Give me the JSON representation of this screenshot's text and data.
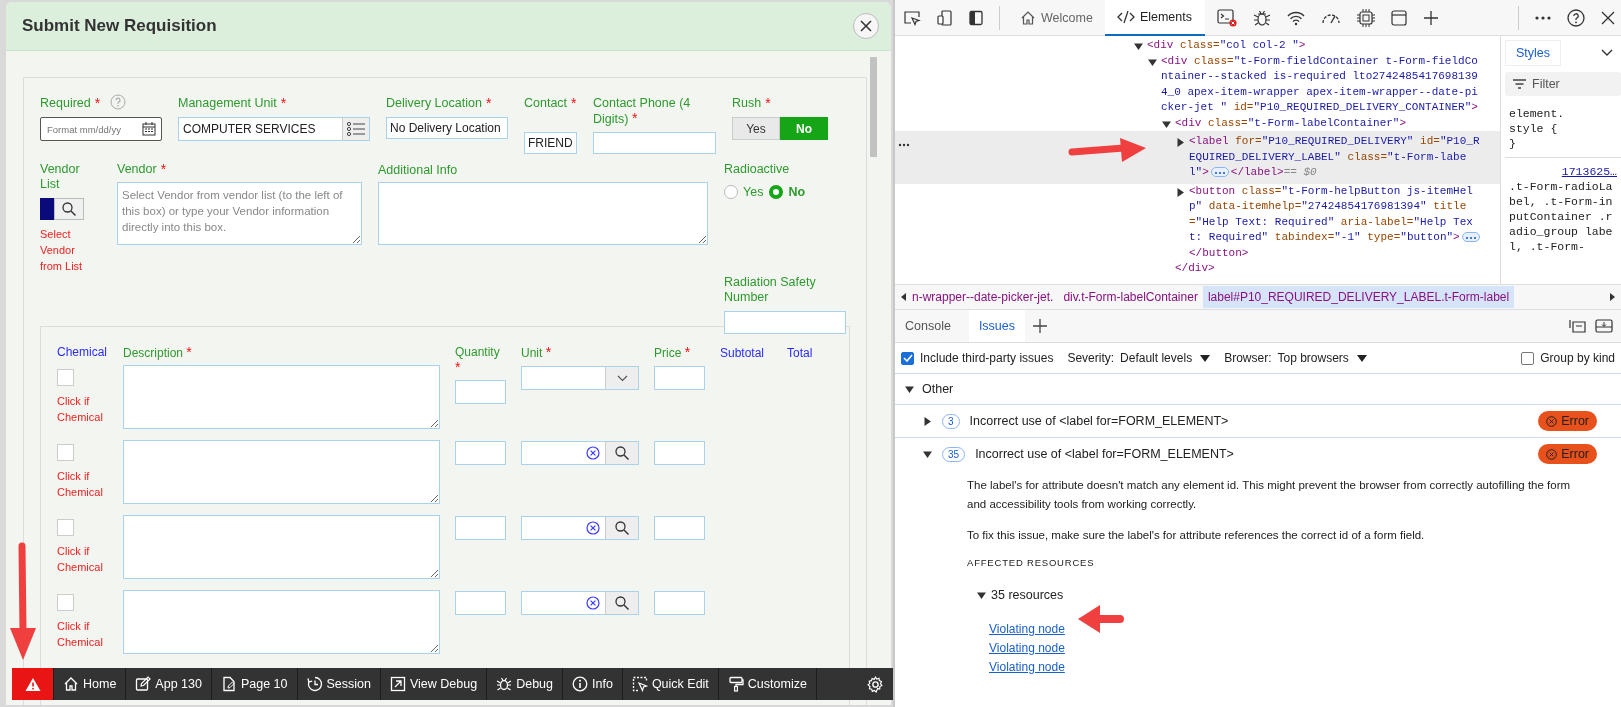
{
  "dialog": {
    "title": "Submit New Requisition",
    "required": {
      "label": "Required",
      "required_mark": "*",
      "placeholder": "Format mm/dd/yy"
    },
    "management_unit": {
      "label": "Management Unit",
      "required_mark": "*",
      "value": "COMPUTER SERVICES"
    },
    "delivery_location": {
      "label": "Delivery Location",
      "required_mark": "*",
      "value": "No Delivery Location"
    },
    "contact": {
      "label": "Contact",
      "required_mark": "*",
      "value": "FRIEND"
    },
    "contact_phone": {
      "label": "Contact Phone (4 Digits)",
      "required_mark": "*"
    },
    "rush": {
      "label": "Rush",
      "required_mark": "*",
      "options": [
        {
          "label": "Yes",
          "selected": false
        },
        {
          "label": "No",
          "selected": true
        }
      ]
    },
    "vendor_list": {
      "label": "Vendor List",
      "hint": "Select Vendor from List"
    },
    "vendor": {
      "label": "Vendor",
      "required_mark": "*",
      "placeholder": "Select Vendor from vendor list (to the left of this box) or type your Vendor information directly into this box."
    },
    "additional_info": {
      "label": "Additional Info"
    },
    "radioactive": {
      "label": "Radioactive",
      "options": [
        {
          "label": "Yes",
          "selected": false
        },
        {
          "label": "No",
          "selected": true
        }
      ]
    },
    "radiation_safety_number": {
      "label": "Radiation Safety Number"
    },
    "line_items": {
      "columns": [
        {
          "label": "Chemical",
          "color": "#2b2bff"
        },
        {
          "label": "Description",
          "required_mark": "*",
          "color": "#2e9a2e"
        },
        {
          "label": "Quantity",
          "required_mark": "*",
          "color": "#2e9a2e"
        },
        {
          "label": "Unit",
          "required_mark": "*",
          "color": "#2e9a2e"
        },
        {
          "label": "Price",
          "required_mark": "*",
          "color": "#2e9a2e"
        },
        {
          "label": "Subtotal",
          "color": "#2b2bff"
        },
        {
          "label": "Total",
          "color": "#2b2bff"
        }
      ],
      "rows": [
        {
          "checked": false,
          "hint": "Click if Chemical",
          "kind": "select"
        },
        {
          "checked": false,
          "hint": "Click if Chemical",
          "kind": "lookup"
        },
        {
          "checked": false,
          "hint": "Click if Chemical",
          "kind": "lookup"
        },
        {
          "checked": false,
          "hint": "Click if Chemical",
          "kind": "lookup"
        }
      ]
    }
  },
  "dev_toolbar": [
    "Home",
    "App 130",
    "Page 10",
    "Session",
    "View Debug",
    "Debug",
    "Info",
    "Quick Edit",
    "Customize"
  ],
  "devtools": {
    "tabs": [
      {
        "label": "Welcome",
        "selected": false
      },
      {
        "label": "Elements",
        "selected": true
      }
    ],
    "tree": [
      {
        "text": "<div class=\"col col-2 \">",
        "expanded": true,
        "selected": false,
        "children": [
          {
            "text": "<div class=\"t-Form-fieldContainer t-Form-fieldContainer--stacked is-required lto27424854176981394_0 apex-item-wrapper apex-item-wrapper--date-picker-jet \" id=\"P10_REQUIRED_DELIVERY_CONTAINER\">",
            "expanded": true,
            "selected": false,
            "children": [
              {
                "text": "<div class=\"t-Form-labelContainer\">",
                "expanded": true,
                "selected": false,
                "close": "</div>",
                "children": [
                  {
                    "text": "<label for=\"P10_REQUIRED_DELIVERY\" id=\"P10_REQUIRED_DELIVERY_LABEL\" class=\"t-Form-label\">",
                    "expanded": false,
                    "selected": true,
                    "close": "</label>",
                    "suffix": "== $0"
                  },
                  {
                    "text": "<button class=\"t-Form-helpButton js-itemHelp\" data-itemhelp=\"27424854176981394\" title=\"Help Text: Required\" aria-label=\"Help Text: Required\" tabindex=\"-1\" type=\"button\">",
                    "expanded": false,
                    "selected": false,
                    "close": "</button>"
                  }
                ]
              }
            ]
          }
        ]
      }
    ],
    "styles": {
      "tab": "Styles",
      "filter": "Filter",
      "lines": [
        "element.",
        "style {",
        "}"
      ],
      "link": "1713625…",
      "rule": ".t-Form-radioLabel, .t-Form-inputContainer .radio_group label, .t-Form-"
    },
    "breadcrumbs": [
      {
        "label": "n-wrapper--date-picker-jet.",
        "selected": false
      },
      {
        "label": "div.t-Form-labelContainer",
        "selected": false
      },
      {
        "label": "label#P10_REQUIRED_DELIVERY_LABEL.t-Form-label",
        "selected": true
      }
    ],
    "drawer_tabs": [
      {
        "label": "Console",
        "selected": false
      },
      {
        "label": "Issues",
        "selected": true
      }
    ],
    "filters": {
      "third_party": {
        "label": "Include third-party issues",
        "checked": true
      },
      "severity": {
        "label": "Severity:",
        "value": "Default levels"
      },
      "browser": {
        "label": "Browser:",
        "value": "Top browsers"
      },
      "group_by_kind": {
        "label": "Group by kind",
        "checked": false
      }
    },
    "group": {
      "label": "Other",
      "expanded": true
    },
    "issues": [
      {
        "count": "3",
        "title": "Incorrect use of <label for=FORM_ELEMENT>",
        "badge": "Error",
        "expanded": false
      },
      {
        "count": "35",
        "title": "Incorrect use of <label for=FORM_ELEMENT>",
        "badge": "Error",
        "expanded": true,
        "paragraphs": [
          "The label's for attribute doesn't match any element id. This might prevent the browser from correctly autofilling the form and accessibility tools from working correctly.",
          "To fix this issue, make sure the label's for attribute references the correct id of a form field."
        ],
        "affected": "AFFECTED RESOURCES",
        "resources": {
          "label": "35 resources",
          "expanded": true,
          "links": [
            "Violating node",
            "Violating node",
            "Violating node"
          ]
        }
      }
    ]
  }
}
